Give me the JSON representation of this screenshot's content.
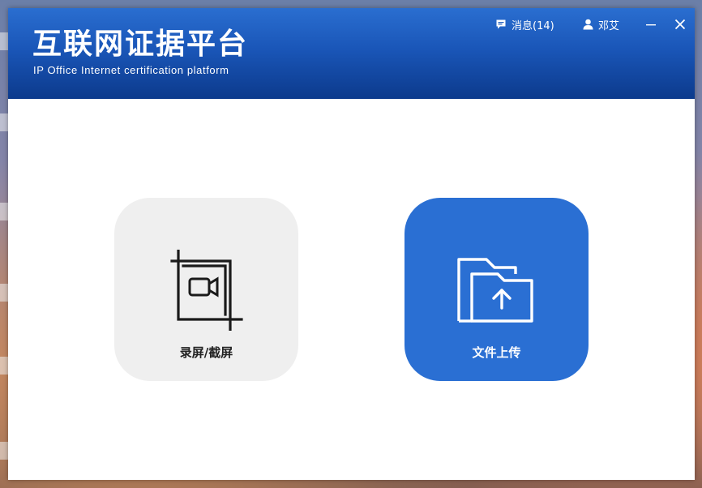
{
  "app": {
    "title": "互联网证据平台",
    "subtitle": "IP Office Internet certification platform"
  },
  "header": {
    "messages_label": "消息(14)",
    "user_name": "邓艾",
    "icons": {
      "messages": "message-icon",
      "user": "user-icon",
      "minimize": "minimize-icon",
      "close": "close-icon"
    }
  },
  "actions": [
    {
      "label": "录屏/截屏",
      "icon": "screen-record-crop-icon"
    },
    {
      "label": "文件上传",
      "icon": "folder-upload-icon"
    }
  ],
  "colors": {
    "header_top": "#2a6ed0",
    "header_bottom": "#0c3a8c",
    "record_card": "#efefef",
    "upload_card": "#2a6fd3"
  }
}
